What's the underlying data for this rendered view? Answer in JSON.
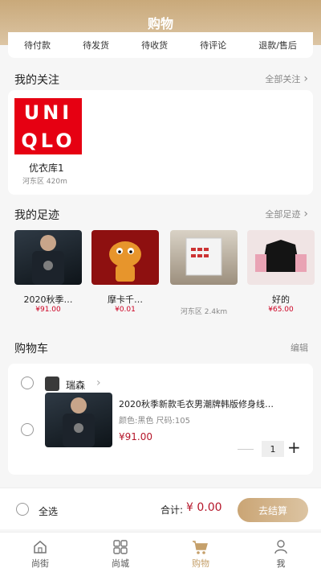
{
  "header": {
    "title": "购物"
  },
  "order_tabs": [
    "待付款",
    "待发货",
    "待收货",
    "待评论",
    "退款/售后"
  ],
  "follow": {
    "title": "我的关注",
    "more": "全部关注",
    "store": {
      "name": "优衣库1",
      "district": "河东区",
      "distance": "420m",
      "logo_lines": [
        "UNI",
        "QLO"
      ]
    }
  },
  "footprint": {
    "title": "我的足迹",
    "more": "全部足迹",
    "items": [
      {
        "title": "2020秋季…",
        "price": "¥91.00"
      },
      {
        "title": "摩卡千…",
        "price": "¥0.01"
      },
      {
        "title": "",
        "district": "河东区",
        "distance": "2.4km"
      },
      {
        "title": "好的",
        "price": "¥65.00"
      }
    ]
  },
  "cart": {
    "title": "购物车",
    "edit": "编辑",
    "shop_name": "瑞森",
    "product": {
      "title": "2020秋季新款毛衣男潮牌韩版修身线…",
      "spec": "颜色:黑色  尺码:105",
      "price": "¥91.00",
      "quantity": "1"
    }
  },
  "checkout": {
    "select_all": "全选",
    "total_label": "合计:",
    "total_value": "¥ 0.00",
    "button": "去结算"
  },
  "tabbar": [
    {
      "label": "尚街",
      "icon": "home-icon",
      "active": false
    },
    {
      "label": "尚城",
      "icon": "grid-icon",
      "active": false
    },
    {
      "label": "购物",
      "icon": "cart-icon",
      "active": true
    },
    {
      "label": "我",
      "icon": "user-icon",
      "active": false
    }
  ],
  "colors": {
    "accent": "#c9a97a",
    "price": "#b5162a",
    "uniqlo_red": "#e60012"
  }
}
